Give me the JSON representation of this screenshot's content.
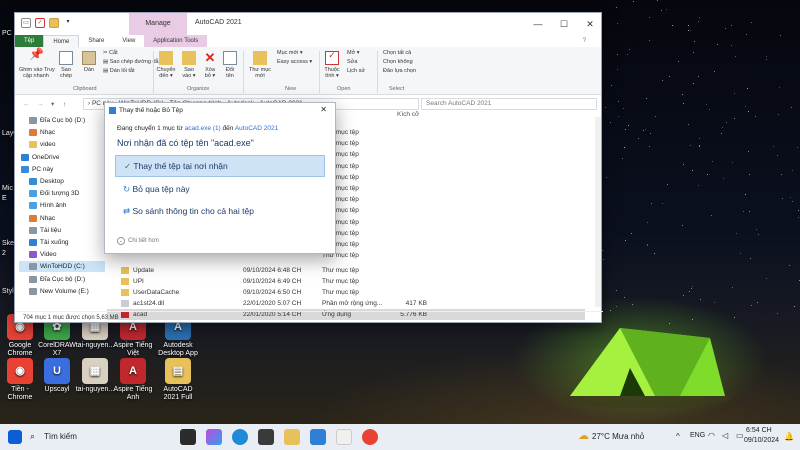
{
  "desktop": {
    "icons": [
      {
        "label": "Google\nChrome",
        "color": "#e94235",
        "glyph": "◉"
      },
      {
        "label": "CorelDRAW\nX7",
        "color": "#3ba64a",
        "glyph": "✿"
      },
      {
        "label": "tai-nguyen...",
        "color": "#d8d0c0",
        "glyph": "▦"
      },
      {
        "label": "Aspire Tiếng\nViệt",
        "color": "#c0282d",
        "glyph": "A"
      },
      {
        "label": "Autodesk\nDesktop App",
        "color": "#2a6fb3",
        "glyph": "A"
      },
      {
        "label": "Tiền -\nChrome",
        "color": "#e94235",
        "glyph": "◉"
      },
      {
        "label": "Upscayl",
        "color": "#3a6ee0",
        "glyph": "U"
      },
      {
        "label": "tai-nguyen...",
        "color": "#d8d0c0",
        "glyph": "▦"
      },
      {
        "label": "Aspire Tiếng\nAnh",
        "color": "#c0282d",
        "glyph": "A"
      },
      {
        "label": "AutoCAD\n2021 Full",
        "color": "#e8c15a",
        "glyph": "▤"
      }
    ],
    "left_labels": [
      "PC",
      "LayO",
      "Mic",
      "E",
      "Sketc",
      "2",
      "Style"
    ]
  },
  "explorer": {
    "manage_tab": "Manage",
    "title": "AutoCAD 2021",
    "tabs": {
      "file": "Tệp",
      "home": "Home",
      "share": "Share",
      "view": "View",
      "app_tools": "Application Tools"
    },
    "ribbon": {
      "pin": "Ghim vào Truy\ncập nhanh",
      "copy": "Sao\nchép",
      "paste": "Dán",
      "cut": "Cắt",
      "copy_path": "Sao chép đường dẫn",
      "paste_shortcut": "Dán lối tắt",
      "clipboard": "Clipboard",
      "move_to": "Chuyển\nđến ▾",
      "copy_to": "Sao\nvào ▾",
      "delete": "Xóa\nbỏ ▾",
      "rename": "Đổi\ntên",
      "organize": "Organize",
      "new_folder": "Thư mục\nmới",
      "new_item": "Mục mới ▾",
      "easy_access": "Easy access ▾",
      "new": "New",
      "properties": "Thuộc\ntính ▾",
      "open": "Mở ▾",
      "edit": "Sửa",
      "history": "Lịch sử",
      "open_group": "Open",
      "select_all": "Chọn tất cả",
      "select_none": "Chọn không",
      "invert": "Đảo lựa chọn",
      "select": "Select"
    },
    "address": "› PC này  ›  WinToHDD (C:)  ›  Tệp Chương trình  ›  Autodesk  ›  AutoCAD 2021",
    "search_placeholder": "Search AutoCAD 2021",
    "size_header": "Kích cỡ",
    "nav": [
      {
        "label": "Đĩa Cục bộ (D:)",
        "color": "#8a96a6"
      },
      {
        "label": "Nhạc",
        "color": "#e07a3a"
      },
      {
        "label": "video",
        "color": "#e8c15a"
      },
      {
        "label": "OneDrive",
        "color": "#2f7fd6"
      },
      {
        "label": "PC này",
        "color": "#3a8ad8"
      },
      {
        "label": "Desktop",
        "color": "#3a8ad8"
      },
      {
        "label": "Đối tượng 3D",
        "color": "#4aa0e0"
      },
      {
        "label": "Hình ảnh",
        "color": "#4aa0e0"
      },
      {
        "label": "Nhạc",
        "color": "#e07a3a"
      },
      {
        "label": "Tài liệu",
        "color": "#8a96a6"
      },
      {
        "label": "Tải xuống",
        "color": "#2f7fd6"
      },
      {
        "label": "Video",
        "color": "#8a5ad0"
      },
      {
        "label": "WinToHDD (C:)",
        "color": "#8a96a6"
      },
      {
        "label": "Đĩa Cục bộ (D:)",
        "color": "#8a96a6"
      },
      {
        "label": "New Volume (E:)",
        "color": "#8a96a6"
      }
    ],
    "bg_types": [
      "Thư mục tệp",
      "Thư mục tệp",
      "Thư mục tệp",
      "Thư mục tệp",
      "Thư mục tệp",
      "Thư mục tệp",
      "Thư mục tệp",
      "Thư mục tệp",
      "Thư mục tệp",
      "Thư mục tệp",
      "Thư mục tệp",
      "Thư mục tệp"
    ],
    "files": [
      {
        "name": "Update",
        "date": "09/10/2024 6:48 CH",
        "type": "Thư mục tệp",
        "size": "",
        "color": "#e8c15a"
      },
      {
        "name": "UPI",
        "date": "09/10/2024 6:49 CH",
        "type": "Thư mục tệp",
        "size": "",
        "color": "#e8c15a"
      },
      {
        "name": "UserDataCache",
        "date": "09/10/2024 6:50 CH",
        "type": "Thư mục tệp",
        "size": "",
        "color": "#e8c15a"
      },
      {
        "name": "ac1st24.dll",
        "date": "22/01/2020 5:07 CH",
        "type": "Phần mở rộng ứng...",
        "size": "417 KB",
        "color": "#c9ccd2"
      },
      {
        "name": "acad",
        "date": "22/01/2020 5:14 CH",
        "type": "Ứng dụng",
        "size": "5.776 KB",
        "color": "#c0282d"
      }
    ],
    "status": "704 mục      1 mục được chọn  5,63 MB"
  },
  "dialog": {
    "title": "Thay thế hoặc Bỏ Tệp",
    "line_pre": "Đang chuyển 1 mục từ ",
    "line_src": "acad.exe (1)",
    "line_mid": " đến ",
    "line_dst": "AutoCAD 2021",
    "heading": "Nơi nhận đã có tệp tên \"acad.exe\"",
    "options": [
      "Thay thế tệp tại nơi nhận",
      "Bỏ qua tệp này",
      "So sánh thông tin cho cả hai tệp"
    ],
    "more": "Chi tiết hơn"
  },
  "taskbar": {
    "search": "Tìm kiếm",
    "weather": "27°C  Mưa nhỏ",
    "lang": "ENG",
    "time": "6:54 CH",
    "date": "09/10/2024"
  },
  "accent": "#2d7d3a"
}
